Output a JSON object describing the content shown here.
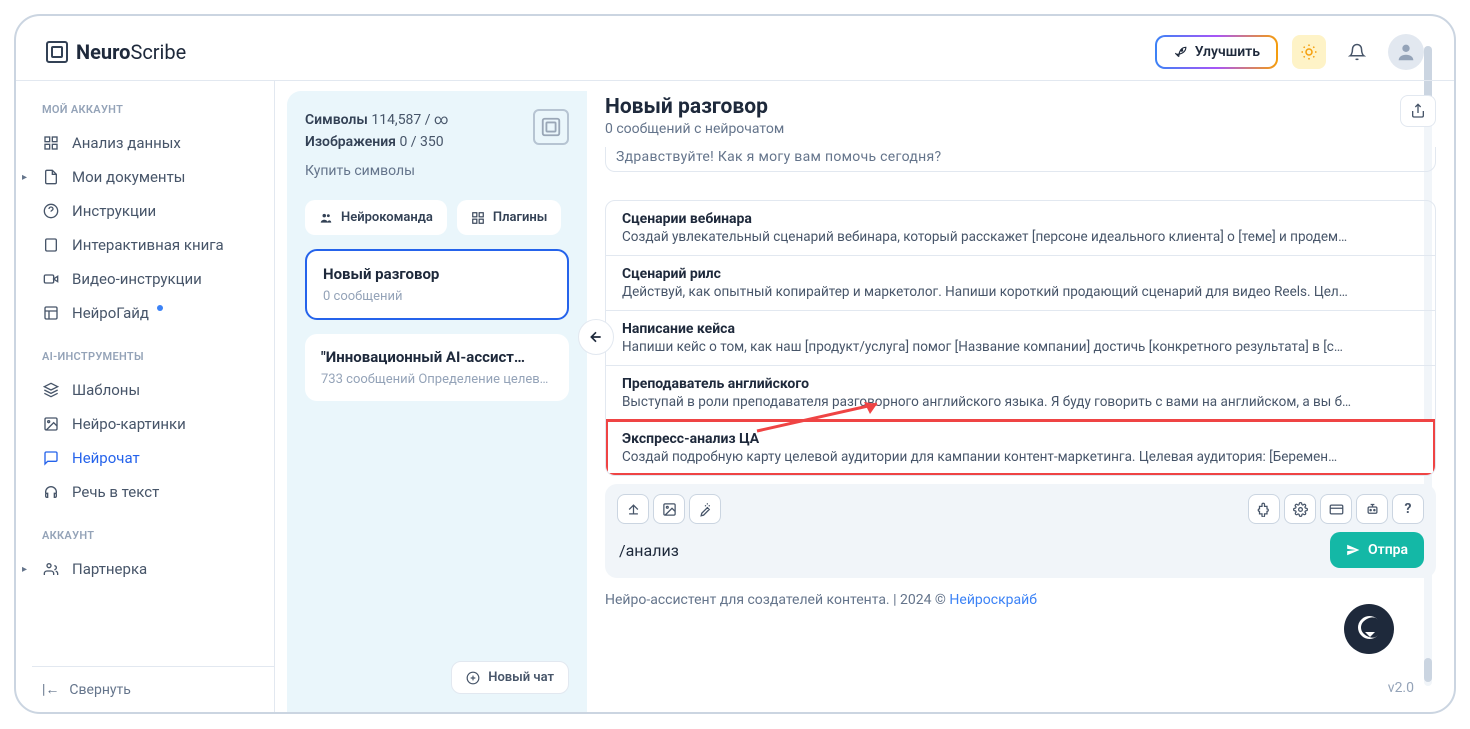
{
  "brand": {
    "name_a": "Neuro",
    "name_b": "Scribe"
  },
  "header": {
    "upgrade_label": "Улучшить"
  },
  "sidebar": {
    "section_account_label": "МОЙ АККАУНТ",
    "section_ai_label": "AI-ИНСТРУМЕНТЫ",
    "section_acct2_label": "АККАУНТ",
    "items_account": [
      {
        "label": "Анализ данных",
        "icon": "grid"
      },
      {
        "label": "Мои документы",
        "icon": "doc",
        "caret": true
      },
      {
        "label": "Инструкции",
        "icon": "help"
      },
      {
        "label": "Интерактивная книга",
        "icon": "book"
      },
      {
        "label": "Видео-инструкции",
        "icon": "video"
      },
      {
        "label": "НейроГайд",
        "icon": "layout",
        "dot": true
      }
    ],
    "items_ai": [
      {
        "label": "Шаблоны",
        "icon": "layers"
      },
      {
        "label": "Нейро-картинки",
        "icon": "image"
      },
      {
        "label": "Нейрочат",
        "icon": "chat",
        "active": true
      },
      {
        "label": "Речь в текст",
        "icon": "headset"
      }
    ],
    "items_acct2": [
      {
        "label": "Партнерка",
        "icon": "users",
        "caret": true
      }
    ],
    "collapse_label": "Свернуть"
  },
  "midpanel": {
    "symbols_label": "Символы",
    "symbols_value": "114,587 / ∞",
    "images_label": "Изображения",
    "images_value": "0 / 350",
    "buy_label": "Купить символы",
    "team_btn": "Нейрокоманда",
    "plugins_btn": "Плагины",
    "conversations": [
      {
        "title": "Новый разговор",
        "sub": "0 сообщений",
        "active": true
      },
      {
        "title": "\"Инновационный AI-ассист…",
        "sub": "733 сообщений Определение целевы…"
      }
    ],
    "newchat_label": "Новый чат"
  },
  "chat": {
    "title": "Новый разговор",
    "subtitle": "0 сообщений с нейрочатом",
    "greeting_fragment": "Здравствуйте! Как я могу вам помочь сегодня?",
    "suggestions": [
      {
        "title": "Сценарии вебинара",
        "desc": "Создай увлекательный сценарий вебинара, который расскажет [персоне идеального клиента] о [теме] и продем…"
      },
      {
        "title": "Сценарий рилс",
        "desc": "Действуй, как опытный копирайтер и маркетолог. Напиши короткий продающий сценарий для видео Reels. Цел…"
      },
      {
        "title": "Написание кейса",
        "desc": "Напиши кейс о том, как наш [продукт/услуга] помог [Название компании] достичь [конкретного результата] в [с…"
      },
      {
        "title": "Преподаватель английского",
        "desc": "Выступай в роли преподавателя разговорного английского языка. Я буду говорить с вами на английском, а вы б…"
      },
      {
        "title": "Экспресс-анализ ЦА",
        "desc": "Создай подробную карту целевой аудитории для кампании контент-маркетинга. Целевая аудитория: [Беремен…",
        "highlight": true
      }
    ],
    "input_value": "/анализ",
    "send_label": "Отправить"
  },
  "footer": {
    "text_a": "Нейро-ассистент для создателей контента.  | 2024 © ",
    "link": "Нейроскрайб",
    "version": "v2.0"
  }
}
